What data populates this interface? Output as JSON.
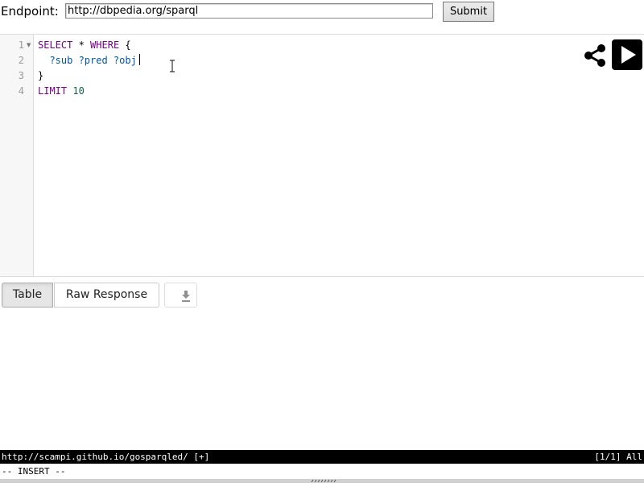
{
  "endpoint": {
    "label": "Endpoint:",
    "value": "http://dbpedia.org/sparql",
    "submit_label": "Submit"
  },
  "editor": {
    "line_numbers": [
      "1",
      "2",
      "3",
      "4"
    ],
    "lines": [
      [
        {
          "t": "SELECT",
          "c": "kw"
        },
        {
          "t": " * ",
          "c": "plain"
        },
        {
          "t": "WHERE",
          "c": "kw"
        },
        {
          "t": " {",
          "c": "plain"
        }
      ],
      [
        {
          "t": "  ?sub ?pred ?obj",
          "c": "var"
        }
      ],
      [
        {
          "t": "}",
          "c": "plain"
        }
      ],
      [
        {
          "t": "LIMIT",
          "c": "kw"
        },
        {
          "t": " ",
          "c": "plain"
        },
        {
          "t": "10",
          "c": "num"
        }
      ]
    ],
    "cursor_line": 2,
    "share_icon": "share-icon",
    "run_icon": "play-icon"
  },
  "tabs": {
    "table_label": "Table",
    "raw_label": "Raw Response",
    "active": "Table",
    "download_icon": "download-icon"
  },
  "statusbar": {
    "url": "http://scampi.github.io/gosparqled/ [+]",
    "position": "[1/1] All"
  },
  "modeline": {
    "text": "-- INSERT --"
  },
  "colors": {
    "keyword": "#770088",
    "variable": "#0055aa",
    "number": "#116644",
    "statusbar_bg": "#000000"
  }
}
